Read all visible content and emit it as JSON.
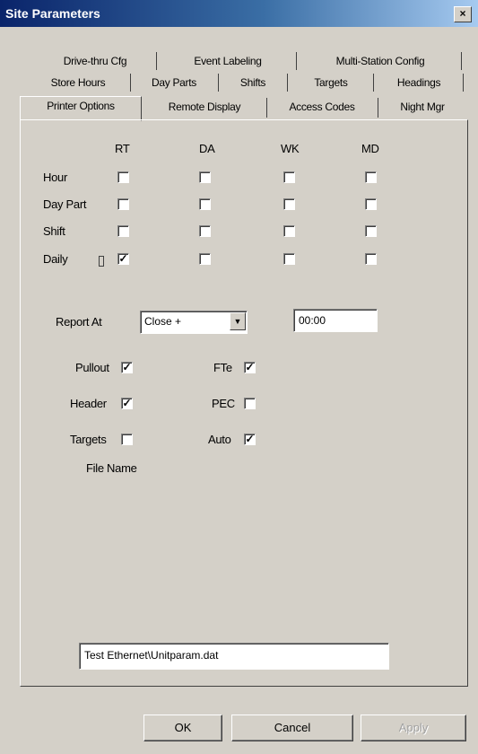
{
  "window": {
    "title": "Site Parameters",
    "close_glyph": "×"
  },
  "tabs": {
    "row1": [
      "Drive-thru Cfg",
      "Event Labeling",
      "Multi-Station Config"
    ],
    "row2": [
      "Store Hours",
      "Day Parts",
      "Shifts",
      "Targets",
      "Headings"
    ],
    "row3": [
      "Printer Options",
      "Remote Display",
      "Access Codes",
      "Night Mgr"
    ],
    "active": "Printer Options"
  },
  "grid": {
    "columns": [
      "RT",
      "DA",
      "WK",
      "MD"
    ],
    "rows": [
      {
        "label": "Hour",
        "checked": [
          false,
          false,
          false,
          false
        ]
      },
      {
        "label": "Day Part",
        "checked": [
          false,
          false,
          false,
          false
        ]
      },
      {
        "label": "Shift",
        "checked": [
          false,
          false,
          false,
          false
        ]
      },
      {
        "label": "Daily",
        "checked": [
          true,
          false,
          false,
          false
        ]
      }
    ]
  },
  "report": {
    "label": "Report At",
    "dropdown_value": "Close +",
    "dropdown_arrow": "▼",
    "time_value": "00:00"
  },
  "options": {
    "left": [
      {
        "label": "Pullout",
        "checked": true
      },
      {
        "label": "Header",
        "checked": true
      },
      {
        "label": "Targets",
        "checked": false
      }
    ],
    "right": [
      {
        "label": "FTe",
        "checked": true
      },
      {
        "label": "PEC",
        "checked": false
      },
      {
        "label": "Auto",
        "checked": true
      }
    ]
  },
  "file": {
    "label": "File Name",
    "value": "Test Ethernet\\Unitparam.dat"
  },
  "buttons": {
    "ok": "OK",
    "cancel": "Cancel",
    "apply": "Apply"
  },
  "check_glyph": "✓"
}
